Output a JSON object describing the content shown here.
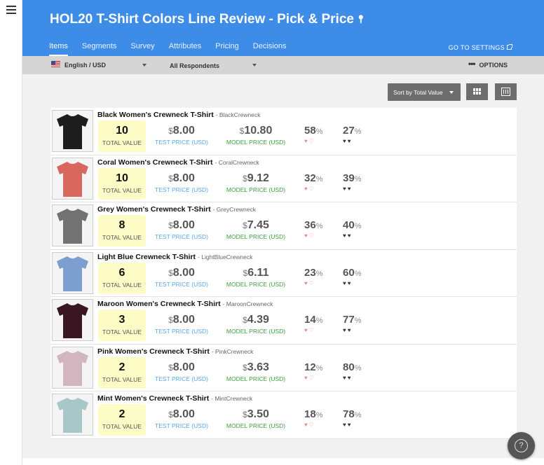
{
  "header": {
    "title": "HOL20 T-Shirt Colors Line Review - Pick & Price",
    "title_icon": "pin-icon",
    "tabs": [
      {
        "label": "Items",
        "active": true
      },
      {
        "label": "Segments"
      },
      {
        "label": "Survey"
      },
      {
        "label": "Attributes"
      },
      {
        "label": "Pricing"
      },
      {
        "label": "Decisions"
      }
    ],
    "settings_link": "GO TO SETTINGS",
    "bg_color": "#3d8ce8"
  },
  "filters": {
    "language": "English / USD",
    "respondents": "All Respondents",
    "options_label": "OPTIONS"
  },
  "toolbar": {
    "sort_label": "Sort by Total Value"
  },
  "labels": {
    "total": "TOTAL VALUE",
    "test": "TEST PRICE (USD)",
    "model": "MODEL PRICE (USD)",
    "currency": "$",
    "percent": "%"
  },
  "items": [
    {
      "name": "Black Women's Crewneck T-Shirt",
      "code": "- BlackCrewneck",
      "color": "#1d1d1d",
      "total": "10",
      "test_price": "8.00",
      "model_price": "10.80",
      "like": "58",
      "dislike": "27"
    },
    {
      "name": "Coral Women's Crewneck T-Shirt",
      "code": "- CoralCrewneck",
      "color": "#d9675f",
      "total": "10",
      "test_price": "8.00",
      "model_price": "9.12",
      "like": "32",
      "dislike": "39"
    },
    {
      "name": "Grey Women's Crewneck T-Shirt",
      "code": "- GreyCrewneck",
      "color": "#727272",
      "total": "8",
      "test_price": "8.00",
      "model_price": "7.45",
      "like": "36",
      "dislike": "40"
    },
    {
      "name": "Light Blue Crewneck T-Shirt",
      "code": "- LightBlueCrewneck",
      "color": "#7d9fcf",
      "total": "6",
      "test_price": "8.00",
      "model_price": "6.11",
      "like": "23",
      "dislike": "60"
    },
    {
      "name": "Maroon Women's Crewneck T-Shirt",
      "code": "- MaroonCrewneck",
      "color": "#3a1622",
      "total": "3",
      "test_price": "8.00",
      "model_price": "4.39",
      "like": "14",
      "dislike": "77"
    },
    {
      "name": "Pink Women's Crewneck T-Shirt",
      "code": "- PinkCrewneck",
      "color": "#d2b6bf",
      "total": "2",
      "test_price": "8.00",
      "model_price": "3.63",
      "like": "12",
      "dislike": "80"
    },
    {
      "name": "Mint Women's Crewneck T-Shirt",
      "code": "- MintCrewneck",
      "color": "#a7c8c6",
      "total": "2",
      "test_price": "8.00",
      "model_price": "3.50",
      "like": "18",
      "dislike": "78"
    }
  ]
}
